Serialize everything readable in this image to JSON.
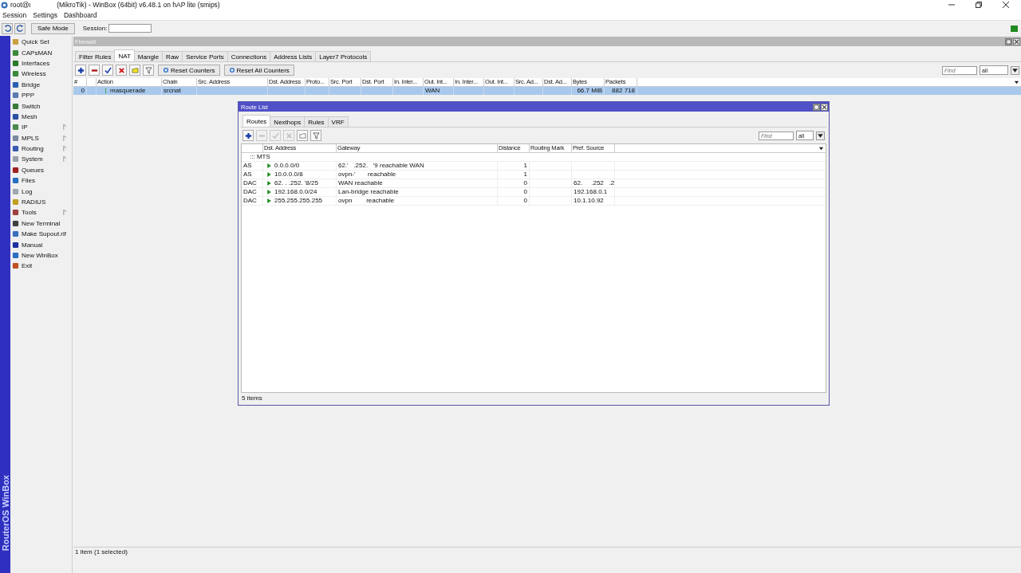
{
  "window": {
    "user": "root@ι",
    "title": "(MikroTik) - WinBox (64bit) v6.48.1 on hAP lite (smips)"
  },
  "menu": [
    "Session",
    "Settings",
    "Dashboard"
  ],
  "toolbar": {
    "safe_mode": "Safe Mode",
    "session_label": "Session:"
  },
  "sidebar": {
    "brand": "RouterOS WinBox",
    "items": [
      {
        "label": "Quick Set",
        "submenu": false
      },
      {
        "label": "CAPsMAN",
        "submenu": false
      },
      {
        "label": "Interfaces",
        "submenu": false
      },
      {
        "label": "Wireless",
        "submenu": false
      },
      {
        "label": "Bridge",
        "submenu": false
      },
      {
        "label": "PPP",
        "submenu": false
      },
      {
        "label": "Switch",
        "submenu": false
      },
      {
        "label": "Mesh",
        "submenu": false
      },
      {
        "label": "IP",
        "submenu": true
      },
      {
        "label": "MPLS",
        "submenu": true
      },
      {
        "label": "Routing",
        "submenu": true
      },
      {
        "label": "System",
        "submenu": true
      },
      {
        "label": "Queues",
        "submenu": false
      },
      {
        "label": "Files",
        "submenu": false
      },
      {
        "label": "Log",
        "submenu": false
      },
      {
        "label": "RADIUS",
        "submenu": false
      },
      {
        "label": "Tools",
        "submenu": true
      },
      {
        "label": "New Terminal",
        "submenu": false
      },
      {
        "label": "Make Supout.rif",
        "submenu": false
      },
      {
        "label": "Manual",
        "submenu": false
      },
      {
        "label": "New WinBox",
        "submenu": false
      },
      {
        "label": "Exit",
        "submenu": false
      }
    ]
  },
  "firewall": {
    "title": "Firewall",
    "tabs": [
      {
        "label": "Filter Rules",
        "selected": false
      },
      {
        "label": "NAT",
        "selected": true
      },
      {
        "label": "Mangle",
        "selected": false
      },
      {
        "label": "Raw",
        "selected": false
      },
      {
        "label": "Service Ports",
        "selected": false
      },
      {
        "label": "Connections",
        "selected": false
      },
      {
        "label": "Address Lists",
        "selected": false
      },
      {
        "label": "Layer7 Protocols",
        "selected": false
      }
    ],
    "buttons": [
      "Reset Counters",
      "Reset All Counters"
    ],
    "find": {
      "placeholder": "Find"
    },
    "filter": "all",
    "columns": [
      "#",
      "",
      "Action",
      "Chain",
      "Src. Address",
      "Dst. Address",
      "Proto...",
      "Src. Port",
      "Dst. Port",
      "In. Inter...",
      "Out. Int...",
      "In. Inter...",
      "Out. Int...",
      "Src. Ad...",
      "Dst. Ad...",
      "Bytes",
      "Packets"
    ],
    "rows": [
      {
        "selected": true,
        "cells": [
          "0",
          "",
          "masquerade",
          "srcnat",
          "",
          "",
          "",
          "",
          "",
          "",
          "WAN",
          "",
          "",
          "",
          "",
          "66.7 MiB",
          "882 718"
        ]
      }
    ]
  },
  "route_list": {
    "title": "Route List",
    "tabs": [
      {
        "label": "Routes",
        "selected": true
      },
      {
        "label": "Nexthops",
        "selected": false
      },
      {
        "label": "Rules",
        "selected": false
      },
      {
        "label": "VRF",
        "selected": false
      }
    ],
    "find": {
      "placeholder": "Find"
    },
    "filter": "all",
    "columns": [
      "",
      "Dst. Address",
      "Gateway",
      "Distance",
      "Routing Mark",
      "Pref. Source"
    ],
    "comment": "::: MTS",
    "rows": [
      {
        "type": "AS",
        "dst": "0.0.0.0/0",
        "gateway": "62.'   .252.   '9 reachable WAN",
        "distance": "1",
        "pref_source": ""
      },
      {
        "type": "AS",
        "dst": "10.0.0.0/8",
        "gateway": "ovpn-'       reachable",
        "distance": "1",
        "pref_source": ""
      },
      {
        "type": "DAC",
        "dst": "62. .   .252.   '8/25",
        "gateway": "WAN reachable",
        "distance": "0",
        "pref_source": "62.     .252   .2"
      },
      {
        "type": "DAC",
        "dst": "192.168.0.0/24",
        "gateway": "Lan-bridge reachable",
        "distance": "0",
        "pref_source": "192.168.0.1"
      },
      {
        "type": "DAC",
        "dst": "255.255.255.255",
        "gateway": "ovpn        reachable",
        "distance": "0",
        "pref_source": "10.1.10.92"
      }
    ],
    "status": "5 items"
  },
  "status_bar": "1 item (1 selected)"
}
